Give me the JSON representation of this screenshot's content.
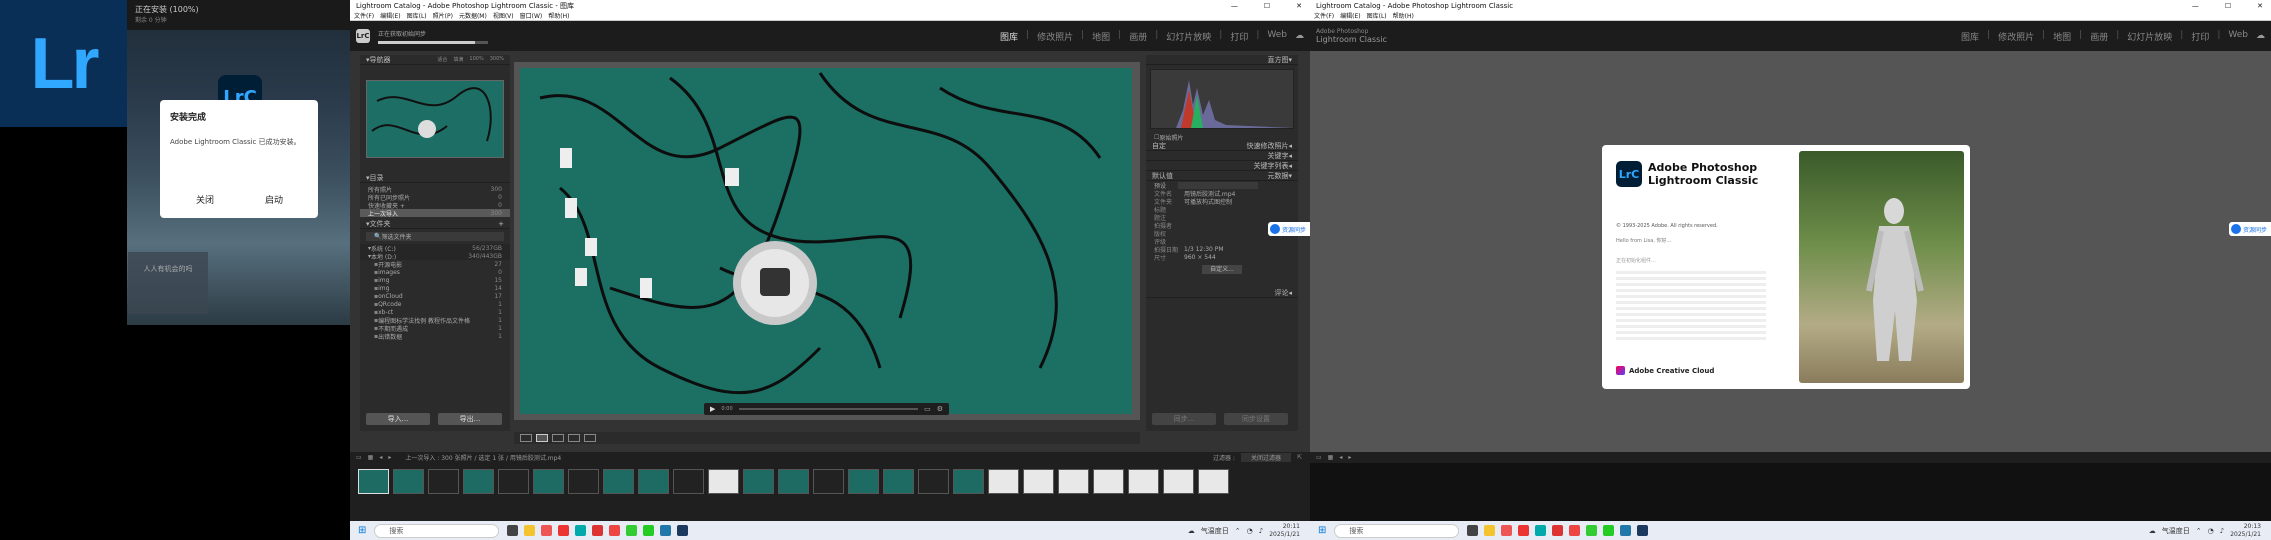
{
  "installer": {
    "tile_text": "Lr",
    "status_title": "正在安装 (100%)",
    "status_sub": "剩余 0 分钟",
    "logo_text": "LrC",
    "mini_text": "人人有机会的吗",
    "dialog": {
      "title": "安装完成",
      "message": "Adobe Lightroom Classic 已成功安装。",
      "close_label": "关闭",
      "launch_label": "启动"
    }
  },
  "left_window": {
    "title": "Lightroom Catalog - Adobe Photoshop Lightroom Classic - 图库",
    "menu": [
      "文件(F)",
      "编辑(E)",
      "图库(L)",
      "照片(P)",
      "元数据(M)",
      "视图(V)",
      "窗口(W)",
      "帮助(H)"
    ],
    "identity": {
      "badge": "LrC",
      "status": "正在获取初始同步"
    },
    "modules": [
      "图库",
      "修改照片",
      "地图",
      "画册",
      "幻灯片放映",
      "打印",
      "Web"
    ],
    "active_module": "图库",
    "navigator": {
      "header": "导航器",
      "zoom": [
        "适合",
        "填满",
        "100%",
        "300%"
      ]
    },
    "catalog": {
      "header": "目录",
      "items": [
        {
          "label": "所有照片",
          "count": "300"
        },
        {
          "label": "所有已同步照片",
          "count": "0"
        },
        {
          "label": "快速收藏夹 +",
          "count": "0"
        },
        {
          "label": "上一次导入",
          "count": "300"
        }
      ]
    },
    "folders": {
      "header": "文件夹",
      "filter": "筛选文件夹",
      "volume1": {
        "label": "系统 (C:)",
        "info": "56/237GB"
      },
      "volume2": {
        "label": "本地 (D:)",
        "info": "340/443GB"
      },
      "items": [
        {
          "label": "开源电影",
          "count": "27"
        },
        {
          "label": "images",
          "count": "0"
        },
        {
          "label": "img",
          "count": "15"
        },
        {
          "label": "img",
          "count": "14"
        },
        {
          "label": "onCloud",
          "count": "17"
        },
        {
          "label": "QRcode",
          "count": "1"
        },
        {
          "label": "xb-ct",
          "count": "1"
        },
        {
          "label": "编程图标学法找例 教程作品文件格",
          "count": "1"
        },
        {
          "label": "不期而遇成",
          "count": "1"
        },
        {
          "label": "出错数据",
          "count": "1"
        }
      ]
    },
    "buttons": {
      "import": "导入...",
      "export": "导出..."
    },
    "histogram": {
      "header": "直方图",
      "original": "原始照片"
    },
    "quick_develop": {
      "label": "快速修改照片",
      "preset": "自定"
    },
    "keywords": {
      "tagging": "关键字",
      "list": "关键字列表"
    },
    "metadata": {
      "header": "元数据",
      "preset_label": "预设",
      "preset_value": "默认值",
      "rows": [
        {
          "label": "文件名",
          "value": "用镜后胶测试.mp4"
        },
        {
          "label": "文件夹",
          "value": "可播放构式图控制"
        },
        {
          "label": "标题",
          "value": ""
        },
        {
          "label": "题注",
          "value": ""
        },
        {
          "label": "拍摄者",
          "value": ""
        },
        {
          "label": "版权",
          "value": ""
        },
        {
          "label": "评级",
          "value": ""
        },
        {
          "label": "拍摄日期",
          "value": "1/3 12:30 PM"
        },
        {
          "label": "尺寸",
          "value": "960 × 544"
        }
      ],
      "customize": "自定义..."
    },
    "comments": "评论",
    "sync_buttons": {
      "sync": "同步...",
      "sync_settings": "同步设置"
    },
    "sync_badge": "资源同步",
    "video_controls": {
      "time": "0:00"
    },
    "filmstrip": {
      "path": "上一次导入 : 300 张照片 / 选定 1 张 / 用镜后胶测试.mp4",
      "filter_label": "过滤器 :",
      "filter_value": "关闭过滤器"
    },
    "taskbar": {
      "search": "搜索",
      "weather": "气温度日",
      "time": "20:11",
      "date": "2025/1/21"
    }
  },
  "right_window": {
    "title": "Lightroom Catalog - Adobe Photoshop Lightroom Classic",
    "menu": [
      "文件(F)",
      "编辑(E)",
      "图库(L)",
      "帮助(H)"
    ],
    "identity": {
      "line1": "Adobe Photoshop",
      "line2": "Lightroom Classic"
    },
    "modules": [
      "图库",
      "修改照片",
      "地图",
      "画册",
      "幻灯片放映",
      "打印",
      "Web"
    ],
    "splash": {
      "badge": "LrC",
      "name1": "Adobe Photoshop",
      "name2": "Lightroom Classic",
      "copyright": "© 1993-2025 Adobe. All rights reserved.",
      "credits_head": "Hello from Lisa, 你好...",
      "loading": "正在初始化组件...",
      "brand": "Adobe Creative Cloud"
    },
    "sync_badge": "资源同步",
    "taskbar": {
      "search": "搜索",
      "weather": "气温度日",
      "time": "20:13",
      "date": "2025/1/21"
    }
  }
}
